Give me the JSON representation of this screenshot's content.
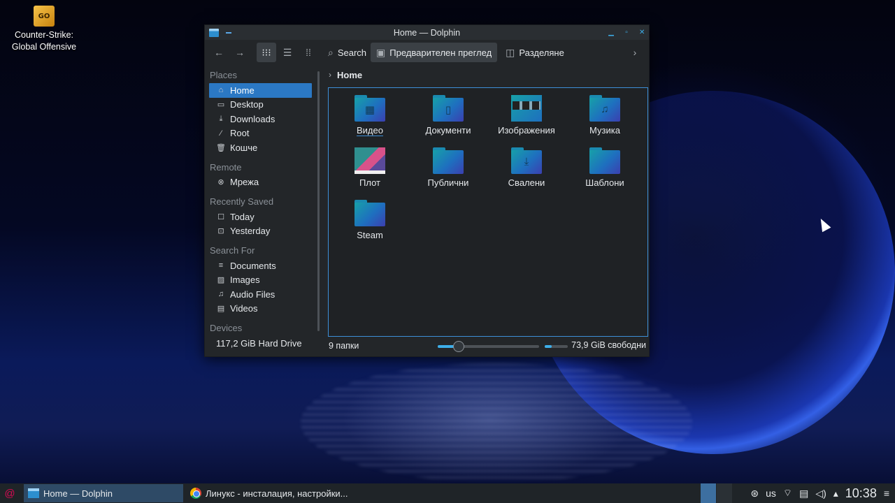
{
  "desktop": {
    "icon_label_line1": "Counter-Strike:",
    "icon_label_line2": "Global Offensive",
    "icon_badge": "GO"
  },
  "window": {
    "title": "Home — Dolphin",
    "toolbar": {
      "search": "Search",
      "preview": "Предварителен преглед",
      "split": "Разделяне"
    }
  },
  "sidebar": {
    "places_title": "Places",
    "places": [
      {
        "label": "Home",
        "icon": "home-icon"
      },
      {
        "label": "Desktop",
        "icon": "desktop-icon"
      },
      {
        "label": "Downloads",
        "icon": "download-icon"
      },
      {
        "label": "Root",
        "icon": "root-icon"
      },
      {
        "label": "Кошче",
        "icon": "trash-icon"
      }
    ],
    "remote_title": "Remote",
    "remote": [
      {
        "label": "Мрежа",
        "icon": "network-icon"
      }
    ],
    "recent_title": "Recently Saved",
    "recent": [
      {
        "label": "Today"
      },
      {
        "label": "Yesterday"
      }
    ],
    "search_title": "Search For",
    "search": [
      {
        "label": "Documents"
      },
      {
        "label": "Images"
      },
      {
        "label": "Audio Files"
      },
      {
        "label": "Videos"
      }
    ],
    "devices_title": "Devices",
    "devices": [
      {
        "label": "117,2 GiB Hard Drive"
      }
    ]
  },
  "breadcrumb": {
    "current": "Home"
  },
  "files": [
    {
      "name": "Видео",
      "type": "folder",
      "icon": "video-folder-icon"
    },
    {
      "name": "Документи",
      "type": "folder",
      "icon": "documents-folder-icon"
    },
    {
      "name": "Изображения",
      "type": "folder",
      "icon": "pictures-folder-icon"
    },
    {
      "name": "Музика",
      "type": "folder",
      "icon": "music-folder-icon"
    },
    {
      "name": "Плот",
      "type": "folder",
      "icon": "desktop-folder-icon"
    },
    {
      "name": "Публични",
      "type": "folder",
      "icon": "public-folder-icon"
    },
    {
      "name": "Свалени",
      "type": "folder",
      "icon": "downloads-folder-icon"
    },
    {
      "name": "Шаблони",
      "type": "folder",
      "icon": "templates-folder-icon"
    },
    {
      "name": "Steam",
      "type": "folder",
      "icon": "folder-icon"
    }
  ],
  "status": {
    "count": "9 папки",
    "free": "73,9 GiB свободни"
  },
  "taskbar": {
    "tasks": [
      {
        "label": "Home — Dolphin"
      },
      {
        "label": "Линукс - инсталация, настройки..."
      }
    ],
    "keyboard_layout": "us",
    "clock": "10:38"
  }
}
